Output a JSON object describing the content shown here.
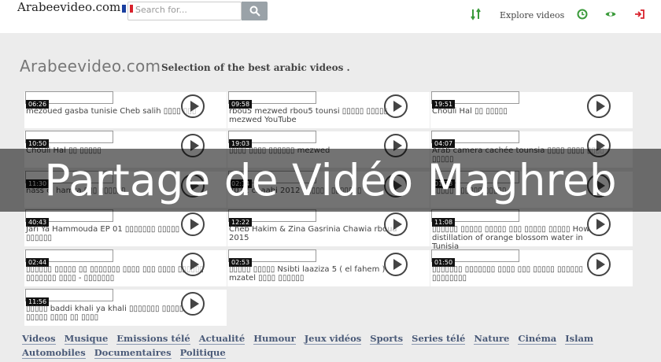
{
  "header": {
    "logo": "Arabeevideo.com",
    "search_placeholder": "Search for...",
    "explore_label": "Explore videos"
  },
  "colors": {
    "flag": [
      "#1a3fa0",
      "#ffffff",
      "#d8212c"
    ],
    "nav_icon": "#3a9a3a",
    "logout_icon": "#d8212c"
  },
  "page": {
    "title": "Arabeevideo.com",
    "subtitle": "Selection of the best arabic videos ."
  },
  "videos": [
    {
      "duration": "06:26",
      "title": "mezoued gasba tunisie Cheb salih ▯▯▯▯ ▯▯▯"
    },
    {
      "duration": "09:58",
      "title": "rbou5 mezwed rbou5 tounsi ▯▯▯▯▯ ▯▯▯▯▯ mezwed YouTube"
    },
    {
      "duration": "19:51",
      "title": "Chouli Hal ▯▯ ▯▯▯▯▯"
    },
    {
      "duration": "10:50",
      "title": "Chouli Hal ▯▯ ▯▯▯▯▯"
    },
    {
      "duration": "19:03",
      "title": "▯▯▯▯ ▯▯▯▯ ▯▯▯▯▯▯ mezwed"
    },
    {
      "duration": "04:07",
      "title": "Arab camera cachée tounsia ▯▯▯▯ ▯▯▯▯ ▯▯▯▯ ▯▯▯▯▯"
    },
    {
      "duration": "11:30",
      "title": "nass el hamra ▯▯▯ ▯▯▯▯▯▯"
    },
    {
      "duration": "02:14",
      "title": "2012 chaabi 2012 ▯▯▯▯▯▯ ▯▯▯▯▯▯▯"
    },
    {
      "duration": "01:38",
      "title": "▯▯▯▯▯ ▯▯▯▯▯▯ ▯▯▯▯▯"
    },
    {
      "duration": "40:43",
      "title": "Jari Ya Hammouda EP 01 ▯▯▯▯▯▯▯ ▯▯▯▯▯ ▯▯▯▯▯▯"
    },
    {
      "duration": "12:22",
      "title": "Cheb Hakim & Zina Gasrinia Chawia rboua 2015"
    },
    {
      "duration": "11:08",
      "title": "▯▯▯▯▯▯ ▯▯▯▯▯ ▯▯▯▯▯ ▯▯▯ ▯▯▯▯▯ ▯▯▯▯▯ How distillation of orange blossom water in Tunisia"
    },
    {
      "duration": "02:44",
      "title": "▯▯▯▯▯▯ ▯▯▯▯▯ ▯▯ ▯▯▯▯▯▯▯ ▯▯▯▯ ▯▯▯ ▯▯▯▯ ▯▯▯▯▯▯ ▯▯▯▯▯▯▯ ▯▯▯▯ - ▯▯▯▯▯▯▯"
    },
    {
      "duration": "02:53",
      "title": "▯▯▯▯▯ ▯▯▯▯▯ Nsibti laaziza 5 ( el fahem ) mzatel ▯▯▯▯ ▯▯▯▯▯▯"
    },
    {
      "duration": "01:50",
      "title": "▯▯▯▯▯▯▯ ▯▯▯▯▯▯▯ ▯▯▯▯ ▯▯▯ ▯▯▯▯▯ ▯▯▯▯▯▯ ▯▯▯▯▯▯▯▯"
    },
    {
      "duration": "11:56",
      "title": "▯▯▯▯▯ baddi khali ya khali ▯▯▯▯▯▯▯ ▯▯▯▯▯ ▯▯▯▯▯ ▯▯▯▯ ▯▯ ▯▯▯▯"
    }
  ],
  "banner": "Partage de Vidéo Maghreb",
  "categories": [
    "Videos",
    "Musique",
    "Emissions télé",
    "Actualité",
    "Humour",
    "Jeux vidéos",
    "Sports",
    "Series télé",
    "Nature",
    "Cinéma",
    "Islam",
    "Automobiles",
    "Documentaires",
    "Politique"
  ]
}
